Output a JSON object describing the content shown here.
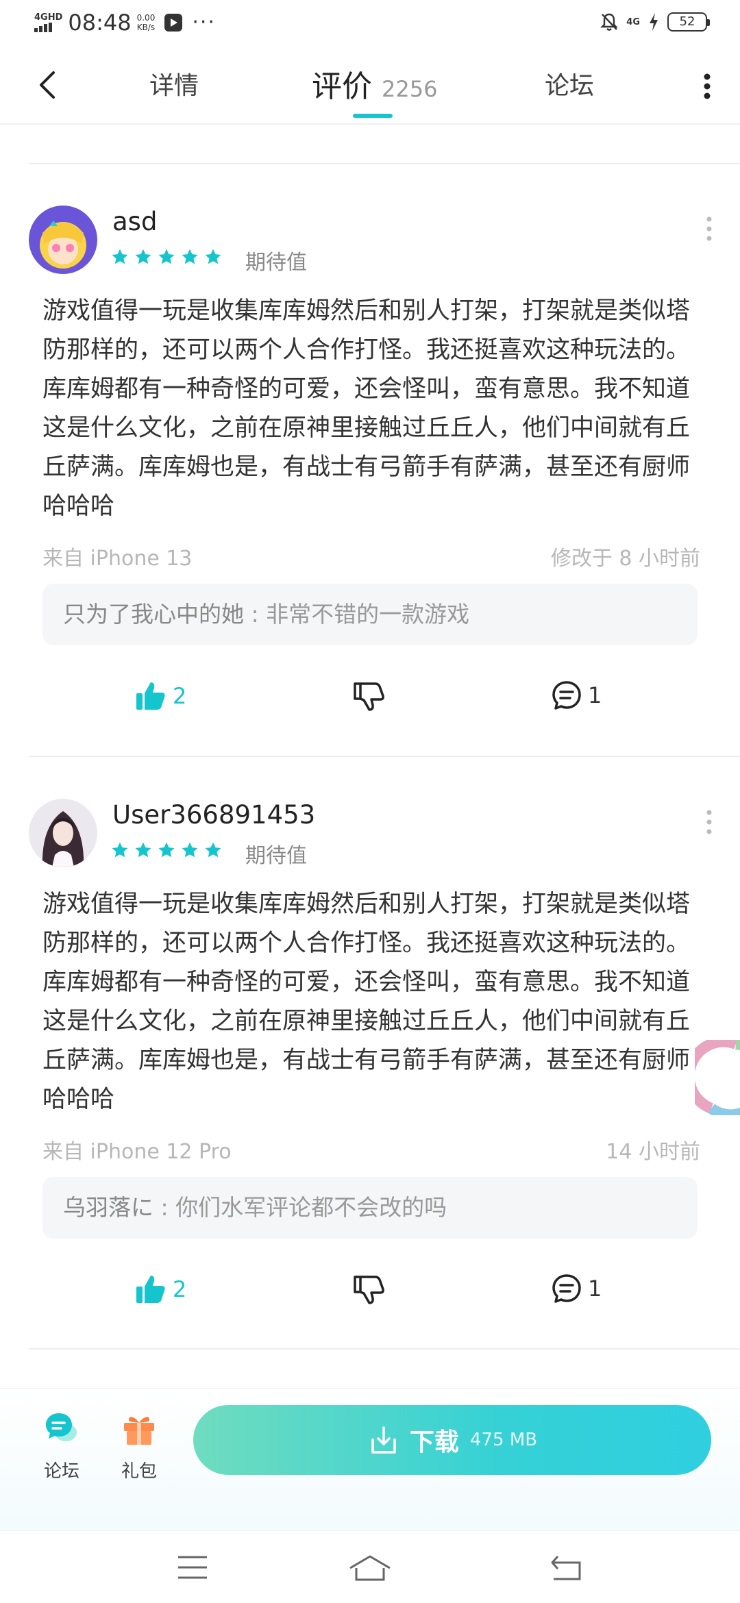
{
  "status_bar": {
    "network_tag": "4GHD",
    "time": "08:48",
    "speed_value": "0.00",
    "speed_unit": "KB/s",
    "network_right": "4G",
    "battery": "52"
  },
  "nav": {
    "tabs": [
      {
        "label": "详情"
      },
      {
        "label": "评价",
        "count": "2256"
      },
      {
        "label": "论坛"
      }
    ]
  },
  "reviews": [
    {
      "username": "asd",
      "stars": 5,
      "rating_label": "期待值",
      "content": "游戏值得一玩是收集库库姆然后和别人打架，打架就是类似塔防那样的，还可以两个人合作打怪。我还挺喜欢这种玩法的。库库姆都有一种奇怪的可爱，还会怪叫，蛮有意思。我不知道这是什么文化，之前在原神里接触过丘丘人，他们中间就有丘丘萨满。库库姆也是，有战士有弓箭手有萨满，甚至还有厨师哈哈哈",
      "device": "来自 iPhone 13",
      "time": "修改于 8 小时前",
      "reply_author": "只为了我心中的她",
      "reply_sep": " : ",
      "reply_text": "非常不错的一款游戏",
      "likes": "2",
      "comments": "1"
    },
    {
      "username": "User366891453",
      "stars": 5,
      "rating_label": "期待值",
      "content": "游戏值得一玩是收集库库姆然后和别人打架，打架就是类似塔防那样的，还可以两个人合作打怪。我还挺喜欢这种玩法的。库库姆都有一种奇怪的可爱，还会怪叫，蛮有意思。我不知道这是什么文化，之前在原神里接触过丘丘人，他们中间就有丘丘萨满。库库姆也是，有战士有弓箭手有萨满，甚至还有厨师哈哈哈",
      "device": "来自 iPhone 12 Pro",
      "time": "14 小时前",
      "reply_author": "乌羽落に",
      "reply_sep": " : ",
      "reply_text": "你们水军评论都不会改的吗",
      "likes": "2",
      "comments": "1"
    }
  ],
  "bottom_bar": {
    "forum_label": "论坛",
    "gift_label": "礼包",
    "download_label": "下载",
    "download_size": "475 MB"
  },
  "colors": {
    "accent": "#15c5ce",
    "star": "#15c5ce",
    "download_gradient_start": "#6fdcbf",
    "download_gradient_end": "#2fcfe0"
  },
  "icons": [
    "back-arrow-icon",
    "more-vertical-icon",
    "star-icon",
    "thumbs-up-icon",
    "thumbs-down-icon",
    "comment-icon",
    "forum-chat-icon",
    "gift-icon",
    "download-icon",
    "menu-icon",
    "home-icon",
    "back-icon"
  ]
}
